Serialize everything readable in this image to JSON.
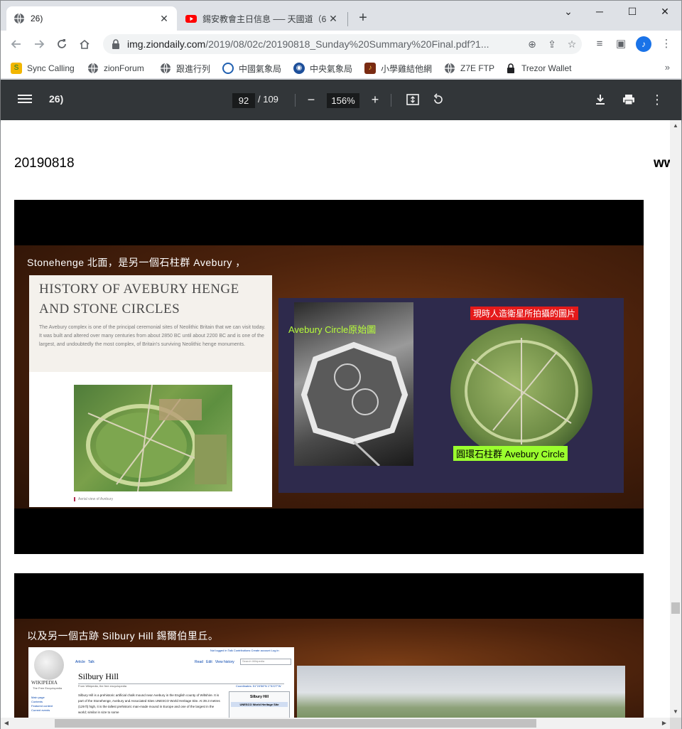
{
  "browser": {
    "tabs": [
      {
        "title": "26)",
        "icon": "globe-icon",
        "active": true
      },
      {
        "title": "錫安教會主日信息 ── 天國道（6",
        "icon": "youtube-icon",
        "active": false
      }
    ],
    "close_glyph": "✕",
    "newtab_glyph": "+",
    "window_controls": {
      "minimize": "─",
      "maximize": "☐",
      "close": "✕",
      "tab_search": "⌄"
    },
    "url_host": "img.ziondaily.com",
    "url_path": "/2019/08/02c/20190818_Sunday%20Summary%20Final.pdf?1...",
    "avatar_letter": "♪",
    "bookmarks": [
      {
        "label": "Sync Calling",
        "icon": "sync-calling-icon"
      },
      {
        "label": "zionForum",
        "icon": "globe-icon"
      },
      {
        "label": "跟進行列",
        "icon": "globe-icon"
      },
      {
        "label": "中國氣象局",
        "icon": "cma-icon"
      },
      {
        "label": "中央氣象局",
        "icon": "cwb-icon"
      },
      {
        "label": "小學雞結他網",
        "icon": "guitar-site-icon"
      },
      {
        "label": "Z7E FTP",
        "icon": "globe-icon"
      },
      {
        "label": "Trezor Wallet",
        "icon": "lock-icon"
      }
    ],
    "bookmarks_more": "»"
  },
  "pdf": {
    "title": "26)",
    "current_page": "92",
    "total_pages": "/ 109",
    "zoom": "156%"
  },
  "page": {
    "date": "20190818",
    "url_fragment": "ww"
  },
  "slide1": {
    "caption": "Stonehenge 北面，是另一個石柱群 Avebury ，",
    "card_title_line1": "HISTORY OF AVEBURY HENGE",
    "card_title_line2": "AND STONE CIRCLES",
    "card_body": "The Avebury complex is one of the principal ceremonial sites of Neolithic Britain that we can visit today. It was built and altered over many centuries from about 2850 BC until about 2200 BC and is one of the largest, and undoubtedly the most complex, of Britain's surviving Neolithic henge monuments.",
    "aerial_caption": "Aerial view of Avebury",
    "label_original": "Avebury Circle原始圖",
    "label_satellite": "現時人造衛星所拍攝的圖片",
    "label_circle": "圓環石柱群 Avebury Circle"
  },
  "slide2": {
    "caption": "以及另一個古跡 Silbury Hill 錫爾伯里丘。",
    "wiki_brand": "WIKIPEDIA",
    "wiki_sub": "The Free Encyclopedia",
    "wiki_title": "Silbury Hill",
    "wiki_from": "From Wikipedia, the free encyclopedia",
    "wiki_text": "Silbury Hill is a prehistoric artificial chalk mound near Avebury in the English county of Wiltshire. It is part of the Stonehenge, Avebury and Associated Sites UNESCO World Heritage Site. At 39.3 metres (129 ft) high, it is the tallest prehistoric man-made mound in Europe and one of the largest in the world; similar in size to some",
    "wiki_side": "Main page\nContents\nFeatured content\nCurrent events",
    "wiki_tabs": "Article   Talk",
    "wiki_right_tabs": "Read   Edit   View history",
    "wiki_search": "Search Wikipedia",
    "wiki_user": "Not logged in  Talk  Contributions  Create account  Log in",
    "wiki_coord": "Coordinates: 51°24′56″N 1°51′27″W",
    "wiki_box_title": "Silbury Hill",
    "wiki_box_unesco": "UNESCO World Heritage Site"
  }
}
